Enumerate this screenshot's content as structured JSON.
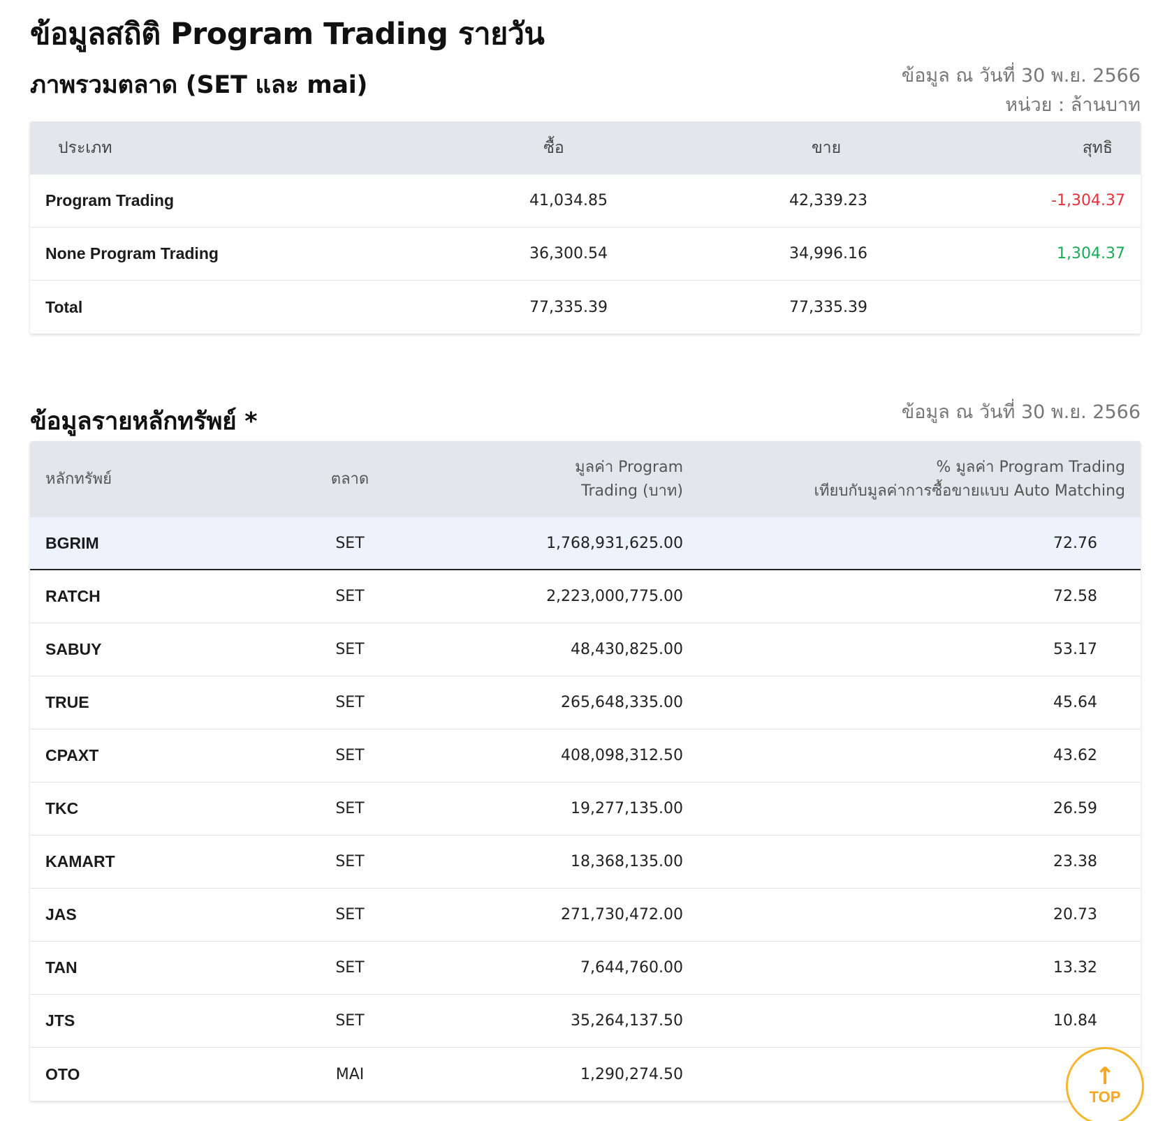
{
  "page": {
    "title": "ข้อมูลสถิติ Program Trading รายวัน"
  },
  "summary": {
    "title": "ภาพรวมตลาด (SET และ mai)",
    "date": "ข้อมูล ณ วันที่ 30 พ.ย. 2566",
    "unit": "หน่วย : ล้านบาท",
    "headers": {
      "type": "ประเภท",
      "buy": "ซื้อ",
      "sell": "ขาย",
      "net": "สุทธิ"
    },
    "rows": [
      {
        "name": "Program Trading",
        "buy": "41,034.85",
        "sell": "42,339.23",
        "net": "-1,304.37",
        "net_status": "neg"
      },
      {
        "name": "None Program Trading",
        "buy": "36,300.54",
        "sell": "34,996.16",
        "net": "1,304.37",
        "net_status": "pos"
      },
      {
        "name": "Total",
        "buy": "77,335.39",
        "sell": "77,335.39",
        "net": "",
        "net_status": ""
      }
    ],
    "colors": {
      "negative": "#e6303b",
      "positive": "#1aaa53"
    }
  },
  "stocks": {
    "title": "ข้อมูลรายหลักทรัพย์ *",
    "date": "ข้อมูล ณ วันที่ 30 พ.ย. 2566",
    "headers": {
      "symbol": "หลักทรัพย์",
      "market": "ตลาด",
      "value_line1": "มูลค่า Program",
      "value_line2": "Trading (บาท)",
      "pct_line1": "% มูลค่า Program Trading",
      "pct_line2": "เทียบกับมูลค่าการซื้อขายแบบ Auto Matching"
    },
    "rows": [
      {
        "symbol": "BGRIM",
        "market": "SET",
        "value": "1,768,931,625.00",
        "pct": "72.76"
      },
      {
        "symbol": "RATCH",
        "market": "SET",
        "value": "2,223,000,775.00",
        "pct": "72.58"
      },
      {
        "symbol": "SABUY",
        "market": "SET",
        "value": "48,430,825.00",
        "pct": "53.17"
      },
      {
        "symbol": "TRUE",
        "market": "SET",
        "value": "265,648,335.00",
        "pct": "45.64"
      },
      {
        "symbol": "CPAXT",
        "market": "SET",
        "value": "408,098,312.50",
        "pct": "43.62"
      },
      {
        "symbol": "TKC",
        "market": "SET",
        "value": "19,277,135.00",
        "pct": "26.59"
      },
      {
        "symbol": "KAMART",
        "market": "SET",
        "value": "18,368,135.00",
        "pct": "23.38"
      },
      {
        "symbol": "JAS",
        "market": "SET",
        "value": "271,730,472.00",
        "pct": "20.73"
      },
      {
        "symbol": "TAN",
        "market": "SET",
        "value": "7,644,760.00",
        "pct": "13.32"
      },
      {
        "symbol": "JTS",
        "market": "SET",
        "value": "35,264,137.50",
        "pct": "10.84"
      },
      {
        "symbol": "OTO",
        "market": "MAI",
        "value": "1,290,274.50",
        "pct": ""
      }
    ]
  },
  "scroll_top": {
    "label": "TOP",
    "icon": "arrow-up-icon",
    "color": "#f5b731"
  }
}
